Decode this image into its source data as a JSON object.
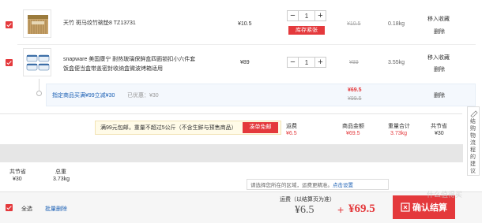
{
  "items": [
    {
      "name": "天竹 斑马纹竹碗垫8 TZ13731",
      "price": "¥10.5",
      "qty": "1",
      "stock_badge": "库存紧张",
      "orig_price": "¥10.5",
      "weight": "0.18kg",
      "actions": [
        "移入收藏",
        "删除"
      ],
      "thumb_icon": "bamboo-mat-icon"
    },
    {
      "name_line1": "snapware 美国康宁 耐热玻璃保鲜盒四面锁扣小六件套",
      "name_line2": "饭盒便当盒带盖密封收纳盒微波烤箱适用",
      "price": "¥89",
      "qty": "1",
      "orig_price": "¥89",
      "weight": "3.55kg",
      "actions": [
        "移入收藏",
        "删除"
      ],
      "thumb_icon": "glass-container-icon"
    }
  ],
  "promo": {
    "text": "指定商品买满¥99立减¥30",
    "discount": "已优惠：¥30",
    "price": "¥69.5",
    "orig_price": "¥99.5",
    "delete": "删除"
  },
  "shipping": {
    "notice": "满99元包邮，重量不超过5公斤（不含生鲜与预售商品）",
    "button": "凑单免邮",
    "labels": {
      "fee": "运费",
      "amount": "商品金额",
      "weight": "重量合计",
      "saved": "共节省"
    },
    "values": {
      "fee": "¥6.5",
      "amount": "¥69.5",
      "weight": "3.73kg",
      "saved": "¥30"
    }
  },
  "sidebar_feedback": "结购物流程的建议",
  "summary": {
    "saved_label": "共节省",
    "saved_value": "¥30",
    "weight_label": "总重",
    "weight_value": "3.73kg"
  },
  "region_tip": {
    "text": "请选择您所在的区域，运费更精准。",
    "link": "点击设置"
  },
  "footer": {
    "select_all": "全选",
    "batch_delete": "批量删除",
    "fee_label": "运费（以结算页为准）",
    "fee_value": "¥6.5",
    "plus": "+",
    "total": "¥69.5",
    "checkout": "确认结算",
    "watermark": "什么值得买"
  }
}
